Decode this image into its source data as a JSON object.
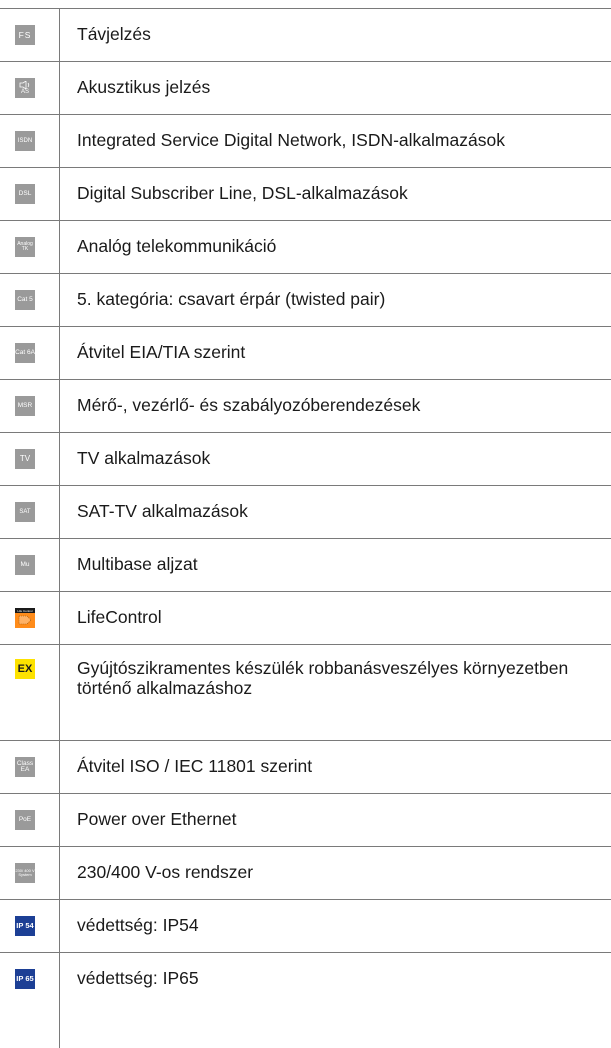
{
  "rows": [
    {
      "icon_name": "fs-icon",
      "icon_text": "FS",
      "label": "Távjelzés"
    },
    {
      "icon_name": "acoustic-signal-icon",
      "icon_text": "AS",
      "label": "Akusztikus jelzés"
    },
    {
      "icon_name": "isdn-icon",
      "icon_text": "ISDN",
      "label": "Integrated Service Digital Network, ISDN-alkalmazások"
    },
    {
      "icon_name": "dsl-icon",
      "icon_text": "DSL",
      "label": "Digital Subscriber Line, DSL-alkalmazások"
    },
    {
      "icon_name": "analog-tk-icon",
      "icon_text": "Analog TK",
      "label": "Analóg telekommunikáció"
    },
    {
      "icon_name": "cat5-icon",
      "icon_text": "Cat 5",
      "label": "5. kategória: csavart érpár (twisted pair)"
    },
    {
      "icon_name": "cat6a-icon",
      "icon_text": "Cat 6A",
      "label": "Átvitel EIA/TIA szerint"
    },
    {
      "icon_name": "msr-icon",
      "icon_text": "MSR",
      "label": "Mérő-, vezérlő- és szabályozóberendezések"
    },
    {
      "icon_name": "tv-icon",
      "icon_text": "TV",
      "label": "TV alkalmazások"
    },
    {
      "icon_name": "sat-icon",
      "icon_text": "SAT",
      "label": "SAT-TV alkalmazások"
    },
    {
      "icon_name": "mu-icon",
      "icon_text": "Mu",
      "label": "Multibase aljzat"
    },
    {
      "icon_name": "lifecontrol-icon",
      "icon_text": "Life Control",
      "label": "LifeControl"
    },
    {
      "icon_name": "ex-icon",
      "icon_text": "EX",
      "label": "Gyújtószikramentes készülék robbanásveszélyes környezetben történő alkalmazáshoz"
    },
    {
      "icon_name": "class-ea-icon",
      "icon_text": "Class EA",
      "label": "Átvitel ISO / IEC 11801 szerint"
    },
    {
      "icon_name": "poe-icon",
      "icon_text": "PoE",
      "label": "Power over Ethernet"
    },
    {
      "icon_name": "system-230-400v-icon",
      "icon_text": "230/ 400 V System",
      "label": "230/400 V-os rendszer"
    },
    {
      "icon_name": "ip54-icon",
      "icon_text": "IP 54",
      "label": "védettség: IP54"
    },
    {
      "icon_name": "ip65-icon",
      "icon_text": "IP 65",
      "label": "védettség: IP65"
    }
  ],
  "colors": {
    "icon_gray": "#9a9a9a",
    "ex_yellow": "#fde200",
    "ip_blue": "#1c3f95",
    "lifecontrol_orange": "#ff8c1a",
    "rule_gray": "#7a7a7a"
  }
}
